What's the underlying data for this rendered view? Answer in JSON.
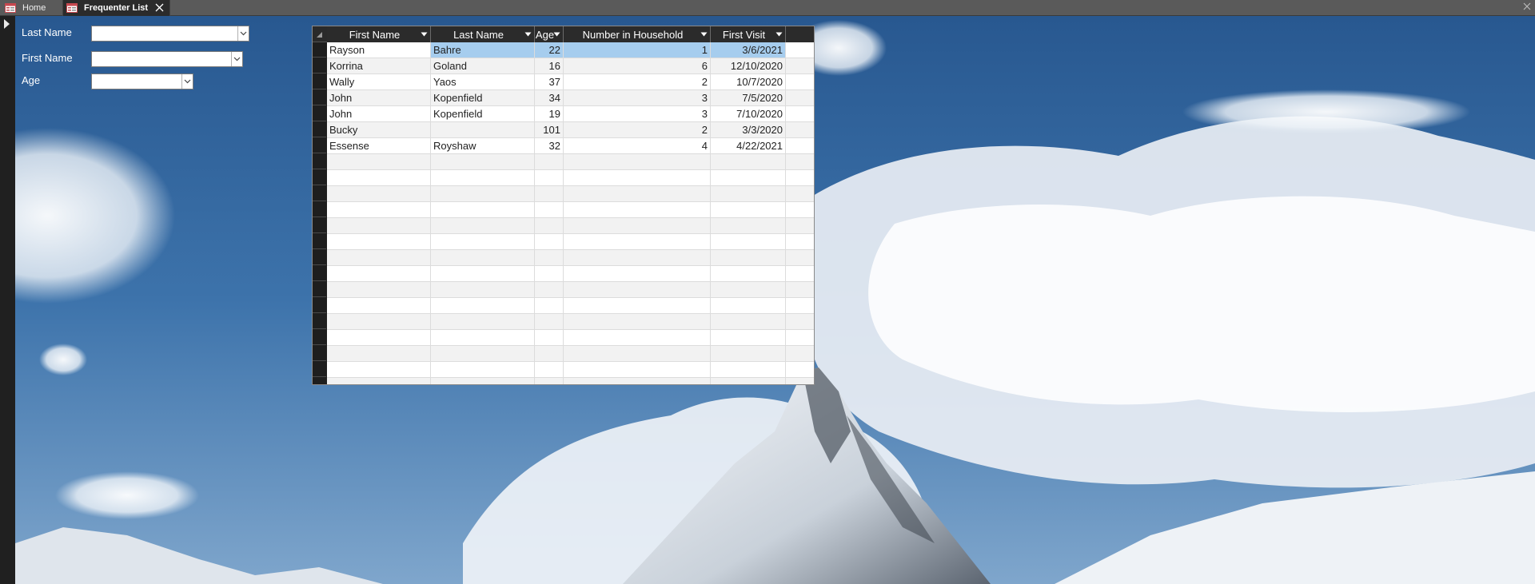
{
  "tabs": [
    {
      "label": "Home",
      "active": false
    },
    {
      "label": "Frequenter List",
      "active": true
    }
  ],
  "filters": {
    "last_name": {
      "label": "Last Name",
      "value": ""
    },
    "first_name": {
      "label": "First Name",
      "value": ""
    },
    "age": {
      "label": "Age",
      "value": ""
    }
  },
  "table": {
    "columns": [
      {
        "key": "first_name",
        "label": "First Name"
      },
      {
        "key": "last_name",
        "label": "Last Name"
      },
      {
        "key": "age",
        "label": "Age"
      },
      {
        "key": "household",
        "label": "Number in Household"
      },
      {
        "key": "first_visit",
        "label": "First Visit"
      }
    ],
    "rows": [
      {
        "first_name": "Rayson",
        "last_name": "Bahre",
        "age": "22",
        "household": "1",
        "first_visit": "3/6/2021"
      },
      {
        "first_name": "Korrina",
        "last_name": "Goland",
        "age": "16",
        "household": "6",
        "first_visit": "12/10/2020"
      },
      {
        "first_name": "Wally",
        "last_name": "Yaos",
        "age": "37",
        "household": "2",
        "first_visit": "10/7/2020"
      },
      {
        "first_name": "John",
        "last_name": "Kopenfield",
        "age": "34",
        "household": "3",
        "first_visit": "7/5/2020"
      },
      {
        "first_name": "John",
        "last_name": "Kopenfield",
        "age": "19",
        "household": "3",
        "first_visit": "7/10/2020"
      },
      {
        "first_name": "Bucky",
        "last_name": "",
        "age": "101",
        "household": "2",
        "first_visit": "3/3/2020"
      },
      {
        "first_name": "Essense",
        "last_name": "Royshaw",
        "age": "32",
        "household": "4",
        "first_visit": "4/22/2021"
      }
    ],
    "selected_row": 0
  },
  "colors": {
    "header_bg": "#2b2b2b",
    "selection": "#a6cdee",
    "tab_active_bg": "#2b2b2b",
    "tab_bar_bg": "#5a5a5a"
  }
}
